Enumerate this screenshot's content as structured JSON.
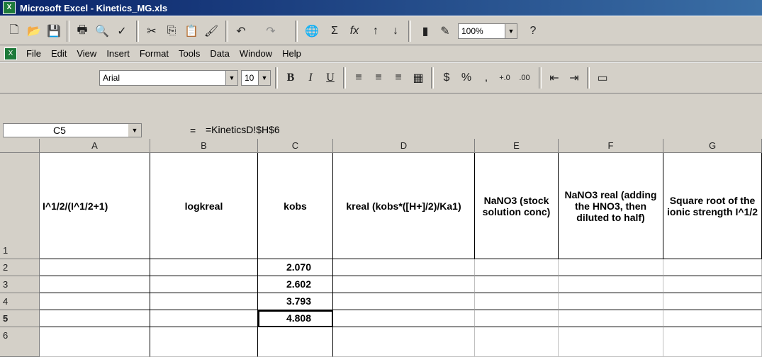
{
  "app": {
    "title": "Microsoft Excel - Kinetics_MG.xls"
  },
  "menu": [
    "File",
    "Edit",
    "View",
    "Insert",
    "Format",
    "Tools",
    "Data",
    "Window",
    "Help"
  ],
  "toolbar": {
    "zoom": "100%",
    "font_name": "Arial",
    "font_size": "10"
  },
  "formula_bar": {
    "name_box": "C5",
    "formula": "=KineticsD!$H$6"
  },
  "columns": [
    "A",
    "B",
    "C",
    "D",
    "E",
    "F",
    "G"
  ],
  "rows": [
    "1",
    "2",
    "3",
    "4",
    "5",
    "6"
  ],
  "headers": {
    "A": "I^1/2/(I^1/2+1)",
    "B": "logkreal",
    "C": "kobs",
    "D": "kreal (kobs*([H+]/2)/Ka1)",
    "E": "NaNO3 (stock solution conc)",
    "F": "NaNO3 real (adding the HNO3, then diluted to half)",
    "G": "Square root of the ionic strength I^1/2"
  },
  "kobs_values": [
    "2.070",
    "2.602",
    "3.793",
    "4.808"
  ]
}
